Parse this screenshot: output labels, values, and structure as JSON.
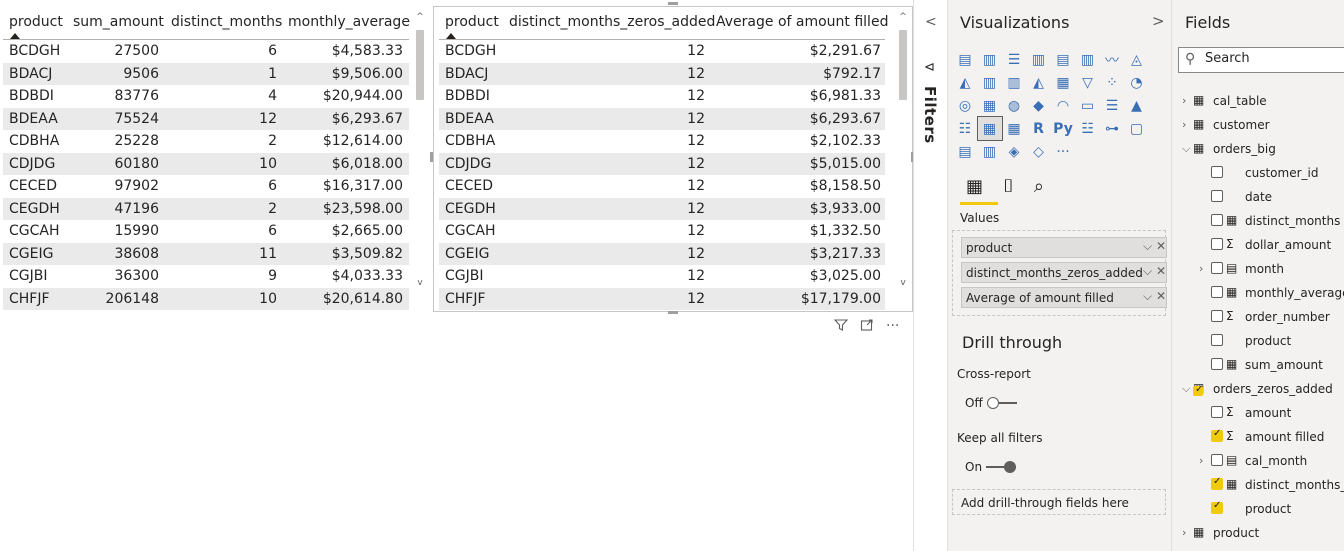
{
  "table_left": {
    "headers": [
      "product",
      "sum_amount",
      "distinct_months",
      "monthly_average"
    ],
    "rows": [
      [
        "BCDGH",
        "27500",
        "6",
        "$4,583.33"
      ],
      [
        "BDACJ",
        "9506",
        "1",
        "$9,506.00"
      ],
      [
        "BDBDI",
        "83776",
        "4",
        "$20,944.00"
      ],
      [
        "BDEAA",
        "75524",
        "12",
        "$6,293.67"
      ],
      [
        "CDBHA",
        "25228",
        "2",
        "$12,614.00"
      ],
      [
        "CDJDG",
        "60180",
        "10",
        "$6,018.00"
      ],
      [
        "CECED",
        "97902",
        "6",
        "$16,317.00"
      ],
      [
        "CEGDH",
        "47196",
        "2",
        "$23,598.00"
      ],
      [
        "CGCAH",
        "15990",
        "6",
        "$2,665.00"
      ],
      [
        "CGEIG",
        "38608",
        "11",
        "$3,509.82"
      ],
      [
        "CGJBI",
        "36300",
        "9",
        "$4,033.33"
      ],
      [
        "CHFJF",
        "206148",
        "10",
        "$20,614.80"
      ]
    ]
  },
  "table_right": {
    "headers": [
      "product",
      "distinct_months_zeros_added",
      "Average of amount filled"
    ],
    "rows": [
      [
        "BCDGH",
        "12",
        "$2,291.67"
      ],
      [
        "BDACJ",
        "12",
        "$792.17"
      ],
      [
        "BDBDI",
        "12",
        "$6,981.33"
      ],
      [
        "BDEAA",
        "12",
        "$6,293.67"
      ],
      [
        "CDBHA",
        "12",
        "$2,102.33"
      ],
      [
        "CDJDG",
        "12",
        "$5,015.00"
      ],
      [
        "CECED",
        "12",
        "$8,158.50"
      ],
      [
        "CEGDH",
        "12",
        "$3,933.00"
      ],
      [
        "CGCAH",
        "12",
        "$1,332.50"
      ],
      [
        "CGEIG",
        "12",
        "$3,217.33"
      ],
      [
        "CGJBI",
        "12",
        "$3,025.00"
      ],
      [
        "CHFJF",
        "12",
        "$17,179.00"
      ]
    ]
  },
  "filters_pane": {
    "label": "Filters"
  },
  "visualizations": {
    "title": "Visualizations",
    "values_label": "Values",
    "wells": [
      {
        "label": "product"
      },
      {
        "label": "distinct_months_zeros_added"
      },
      {
        "label": "Average of amount filled"
      }
    ],
    "drill_through_title": "Drill through",
    "cross_report_label": "Cross-report",
    "cross_report_state": "Off",
    "keep_filters_label": "Keep all filters",
    "keep_filters_state": "On",
    "drill_drop_placeholder": "Add drill-through fields here",
    "accent_color": "#f2c811"
  },
  "fields": {
    "title": "Fields",
    "search_placeholder": "Search",
    "items": [
      {
        "label": "cal_table",
        "type": "table",
        "expand": "collapsed",
        "checked": false
      },
      {
        "label": "customer",
        "type": "table",
        "expand": "collapsed",
        "checked": false
      },
      {
        "label": "orders_big",
        "type": "table",
        "expand": "expanded",
        "checked": false
      },
      {
        "label": "customer_id",
        "type": "field",
        "icon": "none",
        "checked": false
      },
      {
        "label": "date",
        "type": "field",
        "icon": "none",
        "checked": false
      },
      {
        "label": "distinct_months",
        "type": "field",
        "icon": "calc-icon",
        "checked": false
      },
      {
        "label": "dollar_amount",
        "type": "field",
        "icon": "sigma-icon",
        "checked": false
      },
      {
        "label": "month",
        "type": "field",
        "icon": "hierarchy-icon",
        "checked": false,
        "expand": "collapsed"
      },
      {
        "label": "monthly_average",
        "type": "field",
        "icon": "calc-icon",
        "checked": false
      },
      {
        "label": "order_number",
        "type": "field",
        "icon": "sigma-icon",
        "checked": false
      },
      {
        "label": "product",
        "type": "field",
        "icon": "none",
        "checked": false
      },
      {
        "label": "sum_amount",
        "type": "field",
        "icon": "calc-icon",
        "checked": false
      },
      {
        "label": "orders_zeros_added",
        "type": "table",
        "expand": "expanded",
        "checked": true
      },
      {
        "label": "amount",
        "type": "field",
        "icon": "sigma-icon",
        "checked": false
      },
      {
        "label": "amount filled",
        "type": "field",
        "icon": "sigma-icon",
        "checked": true
      },
      {
        "label": "cal_month",
        "type": "field",
        "icon": "hierarchy-icon",
        "checked": false,
        "expand": "collapsed"
      },
      {
        "label": "distinct_months_z...",
        "type": "field",
        "icon": "calc-icon",
        "checked": true
      },
      {
        "label": "product",
        "type": "field",
        "icon": "none",
        "checked": true
      },
      {
        "label": "product",
        "type": "table",
        "expand": "collapsed",
        "checked": false
      }
    ]
  }
}
